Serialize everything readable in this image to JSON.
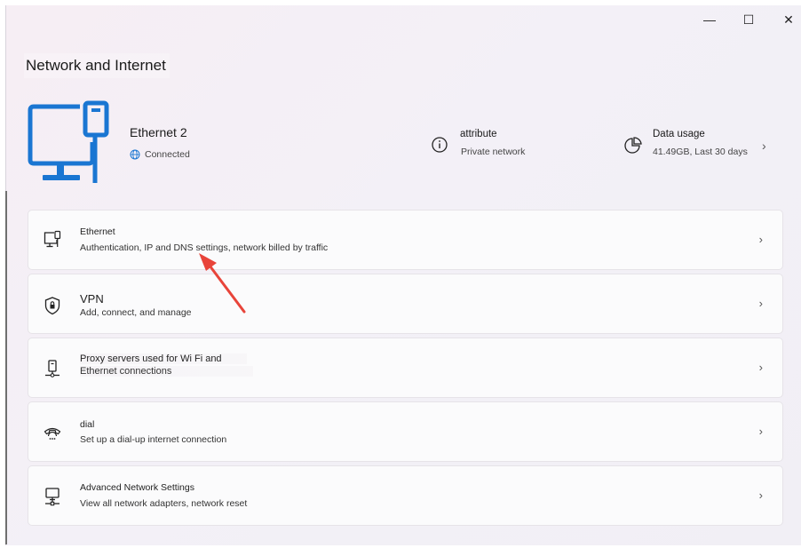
{
  "window": {
    "minimize_glyph": "—",
    "maximize_glyph": "☐",
    "close_glyph": "✕"
  },
  "page_title": "Network and Internet",
  "hero": {
    "name": "Ethernet 2",
    "status": "Connected",
    "attribute_title": "attribute",
    "attribute_value": "Private network",
    "data_usage_title": "Data usage",
    "data_usage_value": "41.49GB, Last 30 days",
    "chevron": "›"
  },
  "cards": [
    {
      "title": "Ethernet",
      "subtitle": "Authentication, IP and DNS settings, network billed by traffic",
      "icon": "ethernet-icon"
    },
    {
      "title": "VPN",
      "subtitle": "Add, connect, and manage",
      "icon": "shield-icon"
    },
    {
      "title": "Proxy servers used for Wi Fi and",
      "subtitle": "Ethernet connections",
      "icon": "proxy-server-icon"
    },
    {
      "title": "dial",
      "subtitle": "Set up a dial-up internet connection",
      "icon": "phone-icon"
    },
    {
      "title": "Advanced Network Settings",
      "subtitle": "View all network adapters, network reset",
      "icon": "computer-network-icon"
    }
  ],
  "chevron": "›",
  "colors": {
    "accent": "#1a76d2",
    "annotation_arrow": "#e8443a"
  }
}
